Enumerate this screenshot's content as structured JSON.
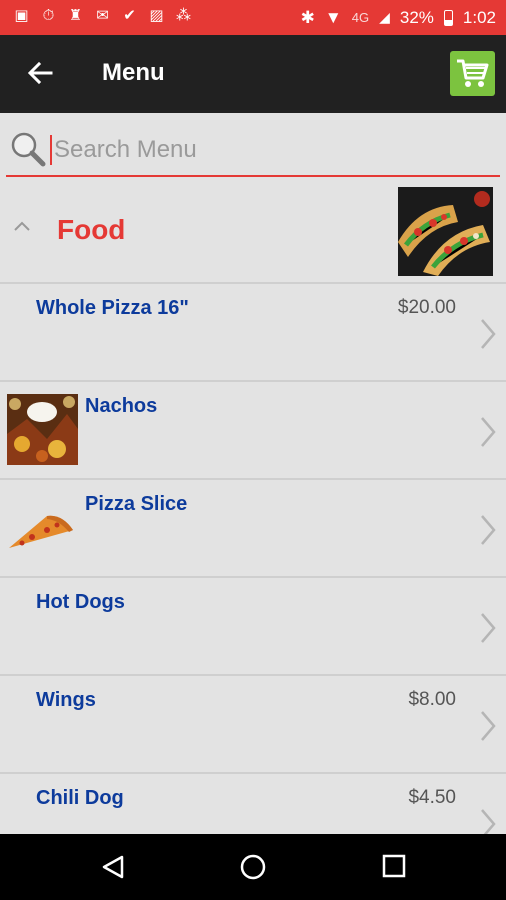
{
  "status_bar": {
    "network": "4G",
    "battery": "32%",
    "time": "1:02"
  },
  "app_bar": {
    "title": "Menu"
  },
  "search": {
    "placeholder": "Search Menu",
    "value": ""
  },
  "category": {
    "title": "Food"
  },
  "items": [
    {
      "name": "Whole Pizza 16\"",
      "price": "$20.00"
    },
    {
      "name": "Nachos",
      "price": ""
    },
    {
      "name": "Pizza Slice",
      "price": ""
    },
    {
      "name": "Hot Dogs",
      "price": ""
    },
    {
      "name": "Wings",
      "price": "$8.00"
    },
    {
      "name": "Chili Dog",
      "price": "$4.50"
    }
  ],
  "colors": {
    "accent": "#e53935",
    "app_bar": "#212121",
    "cart": "#7cc33f",
    "item_name": "#0d3b9c"
  }
}
